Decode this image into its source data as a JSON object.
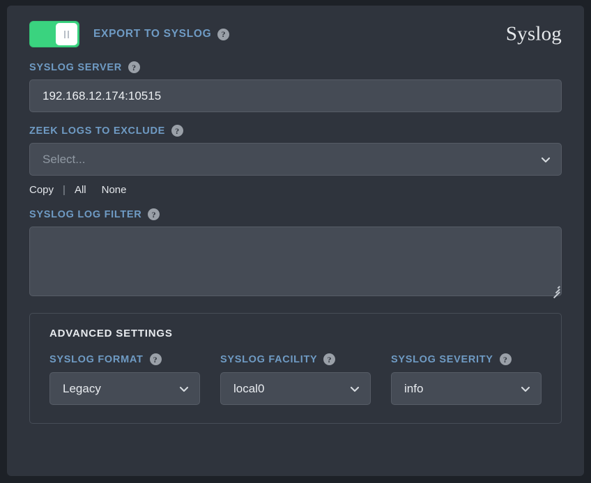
{
  "brand": {
    "title": "Syslog"
  },
  "header": {
    "toggle": {
      "name": "export-to-syslog-toggle",
      "state": "on",
      "knob_icon": "pause-icon"
    },
    "export_label": "EXPORT TO SYSLOG",
    "help_icon": "?"
  },
  "fields": {
    "syslog_server": {
      "label": "SYSLOG SERVER",
      "value": "192.168.12.174:10515",
      "placeholder": ""
    },
    "zeek_logs_to_exclude": {
      "label": "ZEEK LOGS TO EXCLUDE",
      "placeholder": "Select...",
      "value": "",
      "chevron_icon": "chevron-down-icon",
      "links": {
        "copy": "Copy",
        "separator": "|",
        "all": "All",
        "none": "None"
      }
    },
    "syslog_log_filter": {
      "label": "SYSLOG LOG FILTER",
      "value": "",
      "placeholder": ""
    }
  },
  "advanced": {
    "title": "ADVANCED SETTINGS",
    "columns": [
      {
        "label": "SYSLOG FORMAT",
        "value": "Legacy"
      },
      {
        "label": "SYSLOG FACILITY",
        "value": "local0"
      },
      {
        "label": "SYSLOG SEVERITY",
        "value": "info"
      }
    ]
  },
  "colors": {
    "page_background": "#1d2127",
    "panel_background": "#2f343d",
    "label_blue": "#6f9bc4",
    "input_background": "#454b55",
    "input_border": "#565c66",
    "toggle_on_green": "#3ad37f",
    "text_primary": "#eceff2",
    "text_muted": "#9099a3"
  }
}
